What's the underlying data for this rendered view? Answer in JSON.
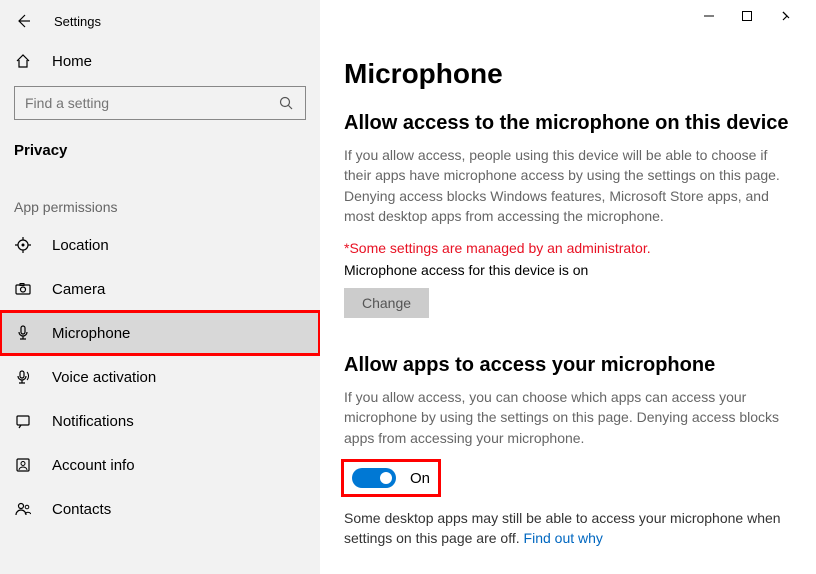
{
  "window": {
    "title": "Settings"
  },
  "sidebar": {
    "home": "Home",
    "search_placeholder": "Find a setting",
    "category": "Privacy",
    "section_label": "App permissions",
    "items": [
      {
        "label": "Location"
      },
      {
        "label": "Camera"
      },
      {
        "label": "Microphone"
      },
      {
        "label": "Voice activation"
      },
      {
        "label": "Notifications"
      },
      {
        "label": "Account info"
      },
      {
        "label": "Contacts"
      }
    ]
  },
  "main": {
    "heading": "Microphone",
    "section1": {
      "title": "Allow access to the microphone on this device",
      "desc": "If you allow access, people using this device will be able to choose if their apps have microphone access by using the settings on this page. Denying access blocks Windows features, Microsoft Store apps, and most desktop apps from accessing the microphone.",
      "admin_note": "*Some settings are managed by an administrator.",
      "status": "Microphone access for this device is on",
      "change_label": "Change"
    },
    "section2": {
      "title": "Allow apps to access your microphone",
      "desc": "If you allow access, you can choose which apps can access your microphone by using the settings on this page. Denying access blocks apps from accessing your microphone.",
      "toggle_state": "On",
      "footnote_text": "Some desktop apps may still be able to access your microphone when settings on this page are off. ",
      "footnote_link": "Find out why"
    }
  }
}
